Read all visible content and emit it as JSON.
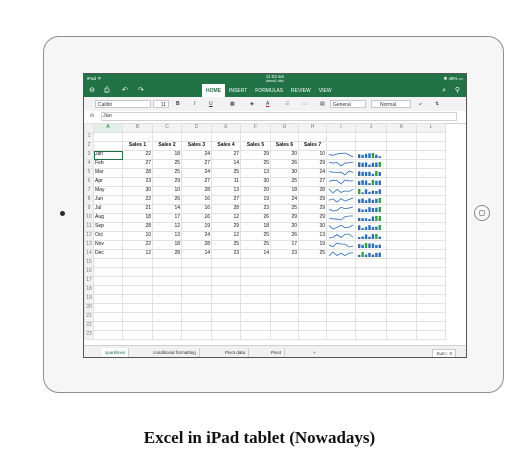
{
  "status": {
    "left": "iPad ᯤ",
    "time": "11:03 am",
    "subtitle": "demo1.xlsx",
    "right": "✱ 48% ▭"
  },
  "ribbon": {
    "tabs": [
      {
        "label": "HOME",
        "active": true
      },
      {
        "label": "INSERT"
      },
      {
        "label": "FORMULAS"
      },
      {
        "label": "REVIEW"
      },
      {
        "label": "VIEW"
      }
    ],
    "back_icon": "⊖",
    "undo_icon": "↶",
    "redo_icon": "↷",
    "save_icon": "⎙",
    "search_icon": "⌕",
    "share_icon": "⚲"
  },
  "toolbar": {
    "font": "Calibri",
    "size": "11",
    "bold": "B",
    "italic": "I",
    "underline": "U",
    "number_format": "General",
    "cell_style": "Normal"
  },
  "formula_bar": {
    "fx": "fx",
    "value": "Jan"
  },
  "columns": [
    "A",
    "B",
    "C",
    "D",
    "E",
    "F",
    "G",
    "H",
    "I",
    "J",
    "K",
    "L"
  ],
  "headers": [
    "",
    "Sales 1",
    "Sales 2",
    "Sales 3",
    "Sales 4",
    "Sales 5",
    "Sales 6",
    "Sales 7"
  ],
  "rows": [
    {
      "month": "Jan",
      "values": [
        22,
        18,
        24,
        27,
        29,
        20,
        10
      ]
    },
    {
      "month": "Feb",
      "values": [
        27,
        25,
        27,
        14,
        25,
        26,
        29
      ]
    },
    {
      "month": "Mar",
      "values": [
        28,
        25,
        24,
        25,
        13,
        30,
        24
      ]
    },
    {
      "month": "Apr",
      "values": [
        23,
        29,
        27,
        11,
        30,
        25,
        27
      ]
    },
    {
      "month": "May",
      "values": [
        30,
        10,
        28,
        13,
        20,
        18,
        28
      ]
    },
    {
      "month": "Jun",
      "values": [
        22,
        26,
        16,
        27,
        19,
        24,
        29
      ]
    },
    {
      "month": "Jul",
      "values": [
        21,
        14,
        16,
        28,
        23,
        25,
        29
      ]
    },
    {
      "month": "Aug",
      "values": [
        18,
        17,
        16,
        12,
        26,
        29,
        29
      ]
    },
    {
      "month": "Sep",
      "values": [
        28,
        12,
        19,
        29,
        18,
        20,
        30
      ]
    },
    {
      "month": "Oct",
      "values": [
        10,
        13,
        24,
        12,
        25,
        26,
        13
      ]
    },
    {
      "month": "Nov",
      "values": [
        22,
        18,
        28,
        25,
        25,
        17,
        19
      ]
    },
    {
      "month": "Dec",
      "values": [
        12,
        28,
        14,
        23,
        14,
        23,
        25
      ]
    }
  ],
  "row_numbers": [
    "1",
    "2",
    "3",
    "4",
    "5",
    "6",
    "7",
    "8",
    "9",
    "10",
    "11",
    "12",
    "13",
    "14",
    "15",
    "16",
    "17",
    "18",
    "19",
    "20",
    "21",
    "22",
    "23"
  ],
  "sheets": [
    {
      "label": "sparklines",
      "active": true
    },
    {
      "label": "conditional formatting"
    },
    {
      "label": "Pivot data"
    },
    {
      "label": "Pivot"
    }
  ],
  "add_sheet": "+",
  "sum": "Sum : 0",
  "caption": "Excel in iPad tablet (Nowadays)",
  "colors": {
    "accent": "#217346",
    "spark_line": "#2e6db4",
    "spark_bar": "#2e6db4",
    "spark_high": "#2ea043"
  }
}
